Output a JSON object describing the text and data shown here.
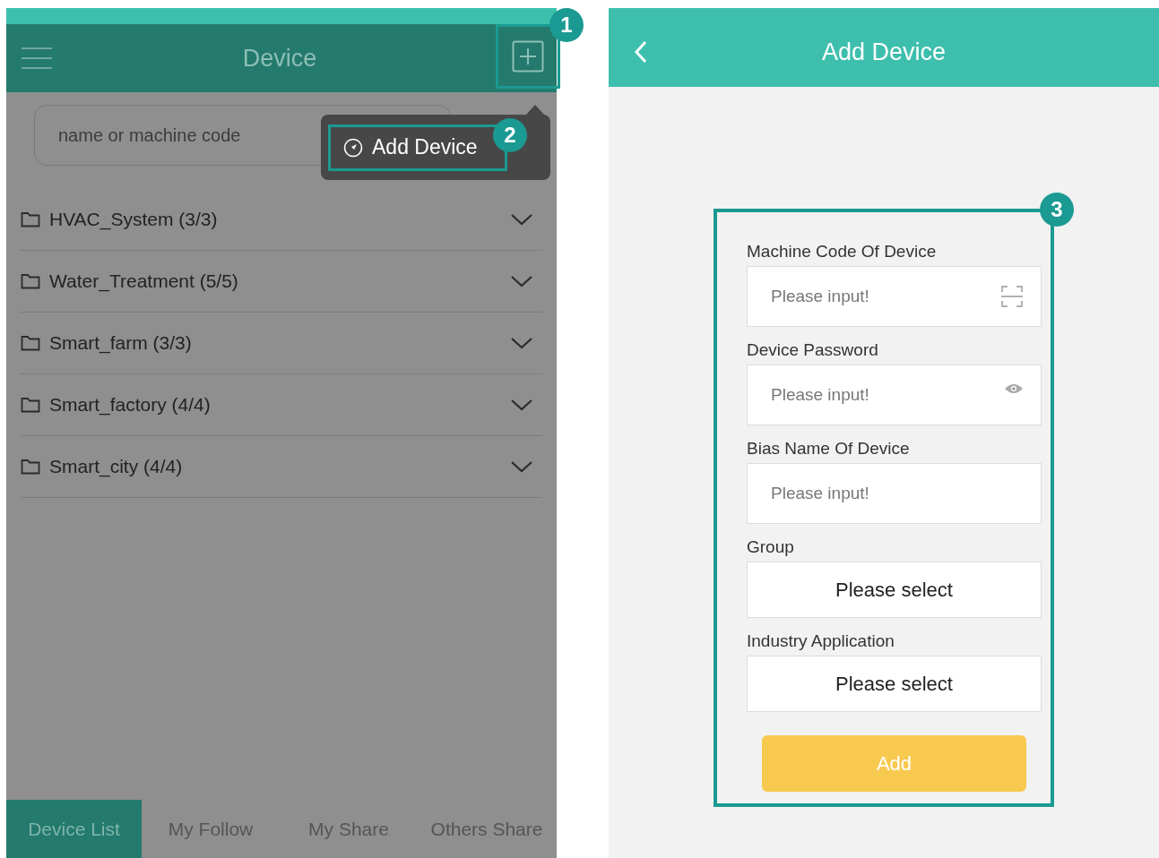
{
  "left_screen": {
    "header": {
      "title": "Device"
    },
    "search": {
      "placeholder": "name or machine code"
    },
    "popup_menu": {
      "items": [
        {
          "label": "Add Device"
        }
      ]
    },
    "groups": [
      {
        "name": "HVAC_System (3/3)"
      },
      {
        "name": "Water_Treatment (5/5)"
      },
      {
        "name": "Smart_farm (3/3)"
      },
      {
        "name": "Smart_factory (4/4)"
      },
      {
        "name": "Smart_city (4/4)"
      }
    ],
    "tabs": [
      {
        "label": "Device List",
        "selected": true
      },
      {
        "label": "My Follow",
        "selected": false
      },
      {
        "label": "My Share",
        "selected": false
      },
      {
        "label": "Others Share",
        "selected": false
      }
    ]
  },
  "right_screen": {
    "header": {
      "title": "Add Device"
    },
    "fields": [
      {
        "label": "Machine Code Of Device",
        "kind": "scan",
        "placeholder": "Please input!"
      },
      {
        "label": "Device Password",
        "kind": "password",
        "placeholder": "Please input!"
      },
      {
        "label": "Bias Name Of Device",
        "kind": "text",
        "placeholder": "Please input!"
      },
      {
        "label": "Group",
        "kind": "select",
        "value": "Please select"
      },
      {
        "label": "Industry Application",
        "kind": "select",
        "value": "Please select"
      }
    ],
    "submit": "Add"
  },
  "callouts": [
    "1",
    "2",
    "3"
  ]
}
